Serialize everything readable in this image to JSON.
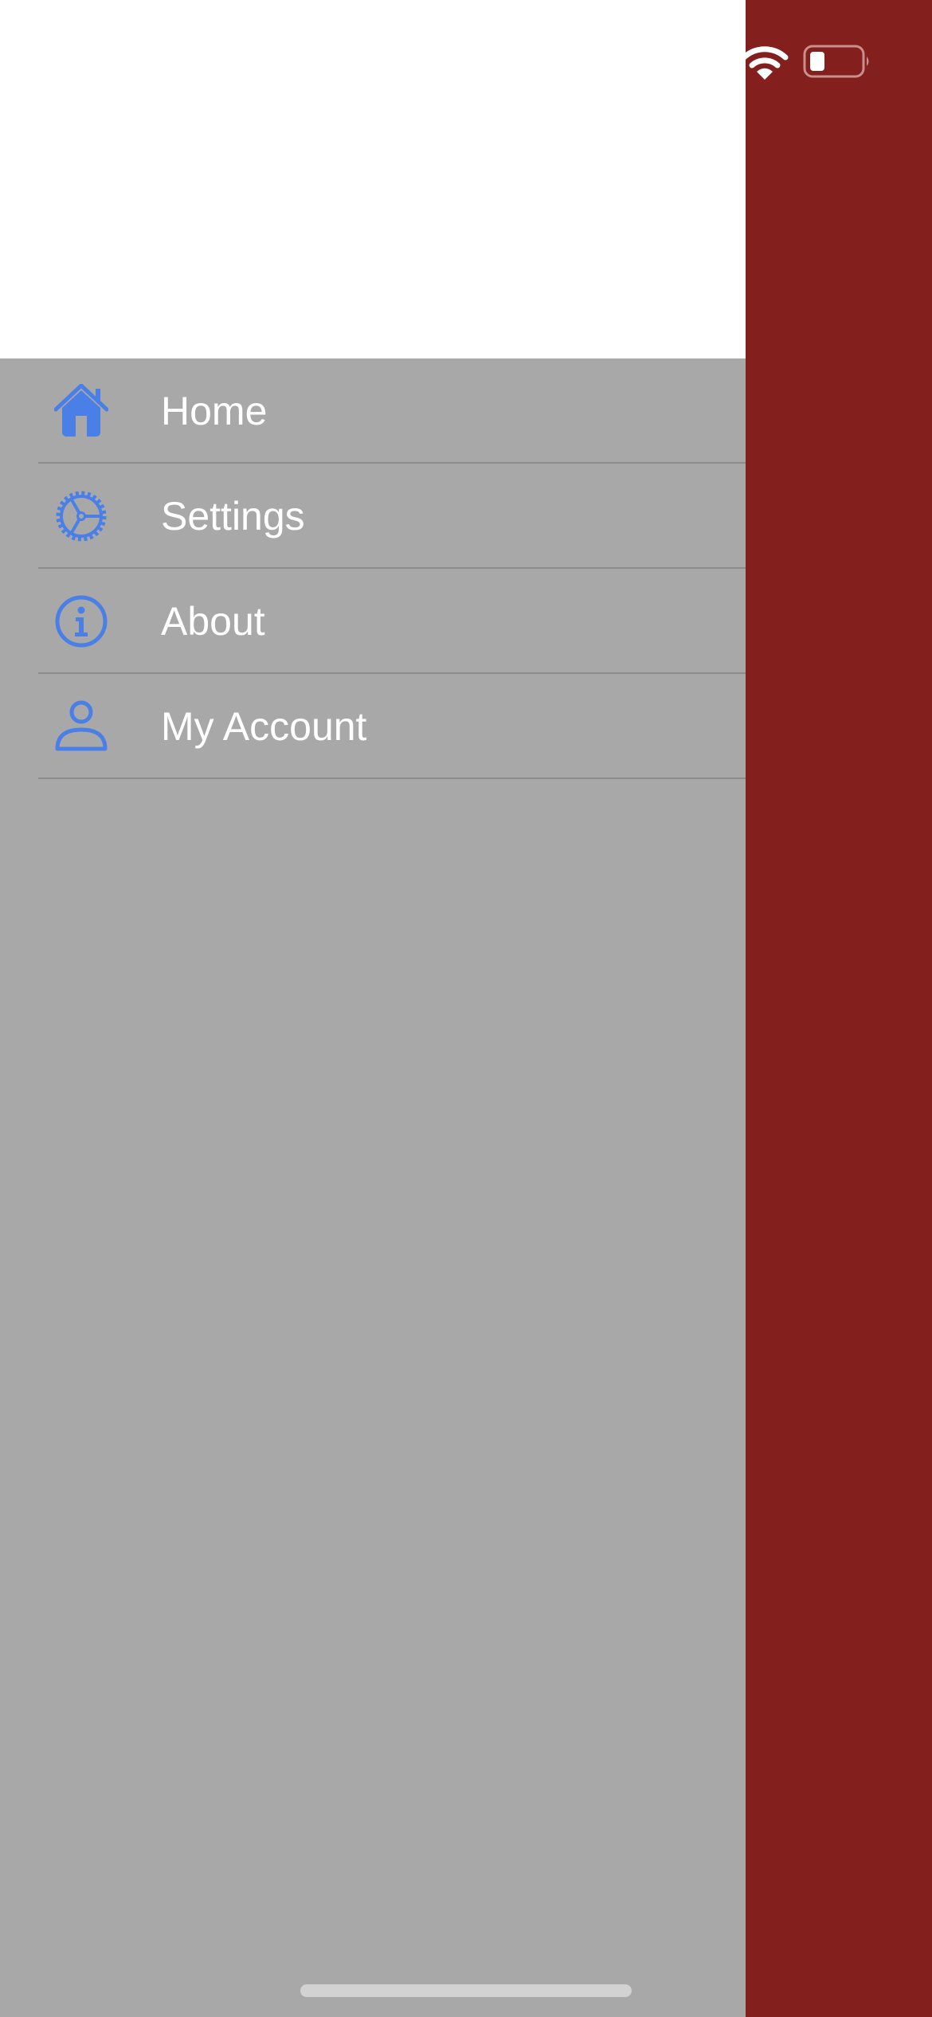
{
  "colors": {
    "main_background": "#831f1c",
    "drawer_background": "#a8a8a8",
    "drawer_header_background": "#ffffff",
    "icon_accent": "#4a7fe8",
    "label_text": "#ffffff",
    "divider": "#8c8c8c"
  },
  "status_bar": {
    "icons": [
      "wifi-icon",
      "battery-icon"
    ]
  },
  "menu": {
    "items": [
      {
        "label": "Home",
        "icon": "home-icon"
      },
      {
        "label": "Settings",
        "icon": "gear-icon"
      },
      {
        "label": "About",
        "icon": "info-icon"
      },
      {
        "label": "My Account",
        "icon": "person-icon"
      }
    ]
  }
}
